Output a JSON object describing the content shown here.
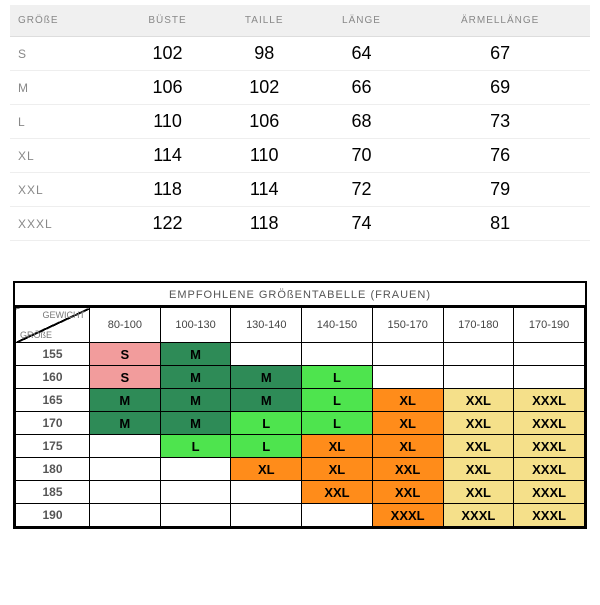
{
  "measurements": {
    "headers": [
      "GRÖßE",
      "BÜSTE",
      "TAILLE",
      "LÄNGE",
      "ÄRMELLÄNGE"
    ],
    "rows": [
      {
        "size": "S",
        "bust": "102",
        "waist": "98",
        "length": "64",
        "sleeve": "67"
      },
      {
        "size": "M",
        "bust": "106",
        "waist": "102",
        "length": "66",
        "sleeve": "69"
      },
      {
        "size": "L",
        "bust": "110",
        "waist": "106",
        "length": "68",
        "sleeve": "73"
      },
      {
        "size": "XL",
        "bust": "114",
        "waist": "110",
        "length": "70",
        "sleeve": "76"
      },
      {
        "size": "XXL",
        "bust": "118",
        "waist": "114",
        "length": "72",
        "sleeve": "79"
      },
      {
        "size": "XXXL",
        "bust": "122",
        "waist": "118",
        "length": "74",
        "sleeve": "81"
      }
    ]
  },
  "recommended": {
    "title": "EMPFOHLENE GRÖßENTABELLE (FRAUEN)",
    "corner": {
      "weight": "GEWICHT",
      "size": "GRÖßE"
    },
    "weight_ranges": [
      "80-100",
      "100-130",
      "130-140",
      "140-150",
      "150-170",
      "170-180",
      "170-190"
    ],
    "heights": [
      "155",
      "160",
      "165",
      "170",
      "175",
      "180",
      "185",
      "190"
    ],
    "cells": [
      [
        {
          "v": "S",
          "c": "pink"
        },
        {
          "v": "M",
          "c": "dgreen"
        },
        {
          "v": "",
          "c": "blank"
        },
        {
          "v": "",
          "c": "blank"
        },
        {
          "v": "",
          "c": "blank"
        },
        {
          "v": "",
          "c": "blank"
        },
        {
          "v": "",
          "c": "blank"
        }
      ],
      [
        {
          "v": "S",
          "c": "pink"
        },
        {
          "v": "M",
          "c": "dgreen"
        },
        {
          "v": "M",
          "c": "dgreen"
        },
        {
          "v": "L",
          "c": "lgreen"
        },
        {
          "v": "",
          "c": "blank"
        },
        {
          "v": "",
          "c": "blank"
        },
        {
          "v": "",
          "c": "blank"
        }
      ],
      [
        {
          "v": "M",
          "c": "dgreen"
        },
        {
          "v": "M",
          "c": "dgreen"
        },
        {
          "v": "M",
          "c": "dgreen"
        },
        {
          "v": "L",
          "c": "lgreen"
        },
        {
          "v": "XL",
          "c": "orange"
        },
        {
          "v": "XXL",
          "c": "yellow"
        },
        {
          "v": "XXXL",
          "c": "yellow"
        }
      ],
      [
        {
          "v": "M",
          "c": "dgreen"
        },
        {
          "v": "M",
          "c": "dgreen"
        },
        {
          "v": "L",
          "c": "lgreen"
        },
        {
          "v": "L",
          "c": "lgreen"
        },
        {
          "v": "XL",
          "c": "orange"
        },
        {
          "v": "XXL",
          "c": "yellow"
        },
        {
          "v": "XXXL",
          "c": "yellow"
        }
      ],
      [
        {
          "v": "",
          "c": "blank"
        },
        {
          "v": "L",
          "c": "lgreen"
        },
        {
          "v": "L",
          "c": "lgreen"
        },
        {
          "v": "XL",
          "c": "orange"
        },
        {
          "v": "XL",
          "c": "orange"
        },
        {
          "v": "XXL",
          "c": "yellow"
        },
        {
          "v": "XXXL",
          "c": "yellow"
        }
      ],
      [
        {
          "v": "",
          "c": "blank"
        },
        {
          "v": "",
          "c": "blank"
        },
        {
          "v": "XL",
          "c": "orange"
        },
        {
          "v": "XL",
          "c": "orange"
        },
        {
          "v": "XXL",
          "c": "orange"
        },
        {
          "v": "XXL",
          "c": "yellow"
        },
        {
          "v": "XXXL",
          "c": "yellow"
        }
      ],
      [
        {
          "v": "",
          "c": "blank"
        },
        {
          "v": "",
          "c": "blank"
        },
        {
          "v": "",
          "c": "blank"
        },
        {
          "v": "XXL",
          "c": "orange"
        },
        {
          "v": "XXL",
          "c": "orange"
        },
        {
          "v": "XXL",
          "c": "yellow"
        },
        {
          "v": "XXXL",
          "c": "yellow"
        }
      ],
      [
        {
          "v": "",
          "c": "blank"
        },
        {
          "v": "",
          "c": "blank"
        },
        {
          "v": "",
          "c": "blank"
        },
        {
          "v": "",
          "c": "blank"
        },
        {
          "v": "XXXL",
          "c": "orange"
        },
        {
          "v": "XXXL",
          "c": "yellow"
        },
        {
          "v": "XXXL",
          "c": "yellow"
        }
      ]
    ],
    "colors": {
      "pink": "#f29c9c",
      "dgreen": "#2e8b57",
      "lgreen": "#4ee44e",
      "orange": "#ff8c1a",
      "yellow": "#f5e08a",
      "blank": "#ffffff"
    }
  }
}
